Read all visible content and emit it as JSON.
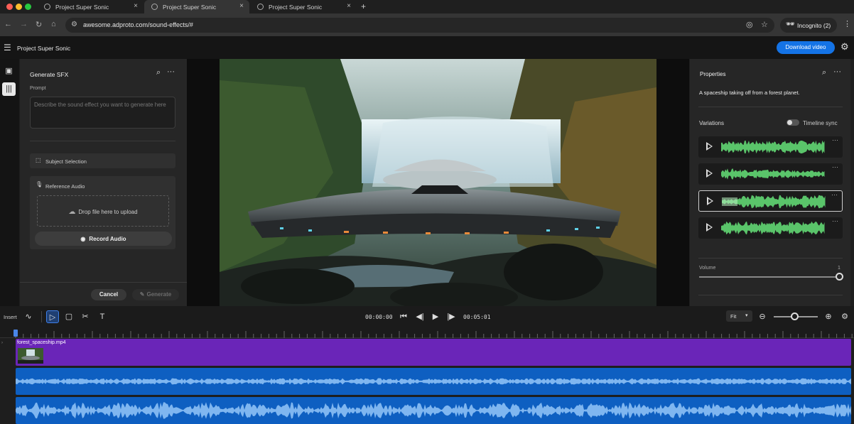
{
  "browser": {
    "tabs": [
      {
        "title": "Project Super Sonic"
      },
      {
        "title": "Project Super Sonic"
      },
      {
        "title": "Project Super Sonic"
      }
    ],
    "url": "awesome.adproto.com/sound-effects/#",
    "incognito_label": "Incognito (2)",
    "colors": {
      "close": "#ff5f57",
      "minimize": "#febc2e",
      "maximize": "#28c840"
    }
  },
  "app": {
    "title": "Project Super Sonic",
    "download_label": "Download video",
    "accent": "#1473e6"
  },
  "generate_panel": {
    "title": "Generate SFX",
    "prompt_label": "Prompt",
    "prompt_placeholder": "Describe the sound effect you want to generate here",
    "subject_selection": "Subject Selection",
    "reference_audio": "Reference Audio",
    "drop_text": "Drop file here to upload",
    "record_label": "Record Audio",
    "cancel_label": "Cancel",
    "generate_label": "Generate"
  },
  "properties": {
    "title": "Properties",
    "description": "A spaceship taking off from a forest planet.",
    "variations_label": "Variations",
    "timeline_sync_label": "Timeline sync",
    "variation_count": 4,
    "selected_variation": 3,
    "volume_label": "Volume",
    "volume_value": "1",
    "waveform_color": "#5ac46a"
  },
  "timeline": {
    "insert_label": "Insert",
    "current_time": "00:00:00",
    "duration": "00:05:01",
    "zoom_option": "Fit",
    "video_clip_name": "forest_spaceship.mp4",
    "video_track_color": "#6a25b8",
    "audio_track_color": "#0e5fc1"
  }
}
